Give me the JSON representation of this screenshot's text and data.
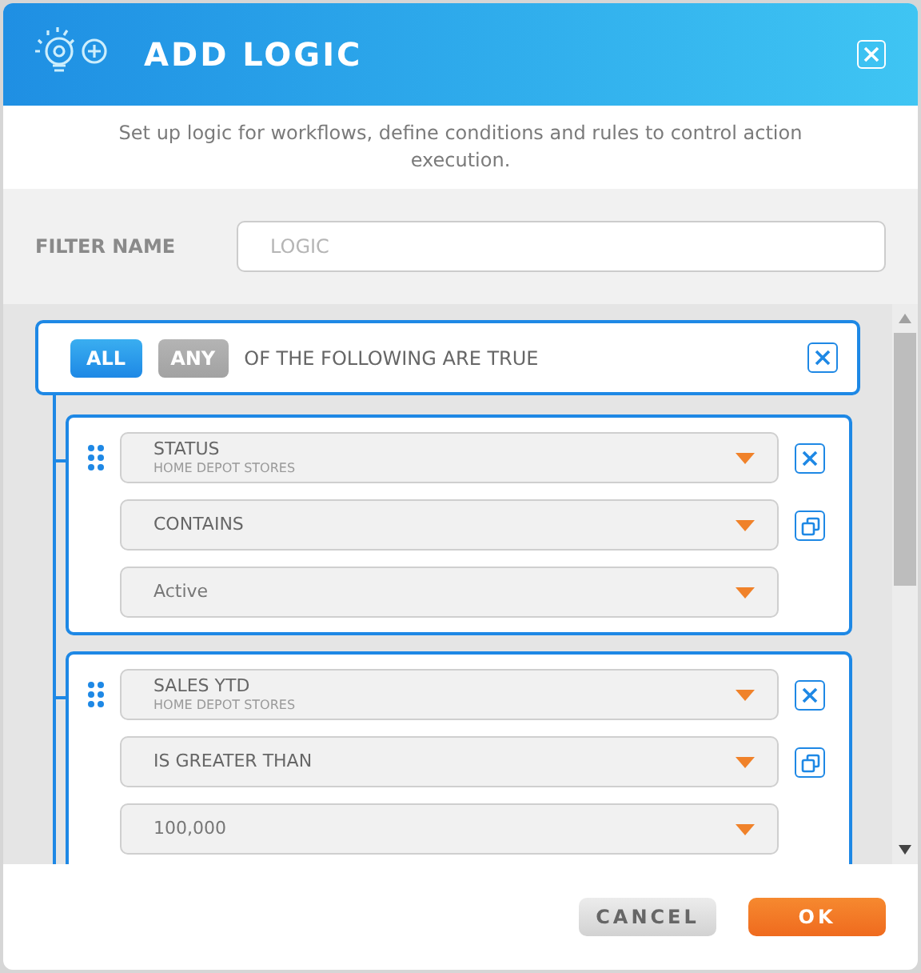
{
  "window": {
    "title": "ADD LOGIC"
  },
  "description": "Set up logic for workflows, define conditions and rules to control action execution.",
  "filter": {
    "label": "FILTER NAME",
    "placeholder": "LOGIC"
  },
  "group": {
    "match": [
      {
        "label": "ALL",
        "selected": true
      },
      {
        "label": "ANY",
        "selected": false
      }
    ],
    "text": "OF THE FOLLOWING ARE TRUE"
  },
  "rules": [
    {
      "field": "STATUS",
      "source": "HOME DEPOT STORES",
      "operator": "CONTAINS",
      "value": "Active"
    },
    {
      "field": "SALES YTD",
      "source": "HOME DEPOT STORES",
      "operator": "IS GREATER THAN",
      "value": "100,000"
    }
  ],
  "buttons": [
    {
      "label": "CANCEL",
      "kind": "secondary"
    },
    {
      "label": "OK",
      "kind": "primary"
    }
  ]
}
